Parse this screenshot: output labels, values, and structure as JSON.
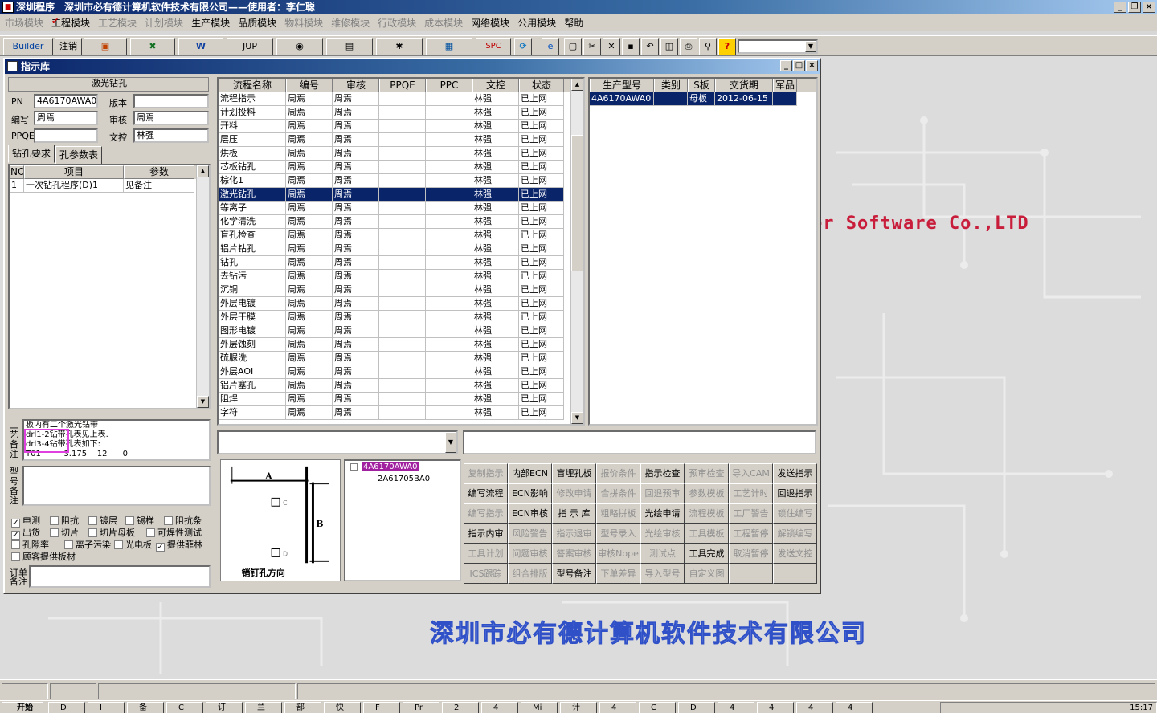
{
  "window": {
    "title": "深圳程序　深圳市必有德计算机软件技术有限公司——使用者：李仁聪"
  },
  "menu": [
    {
      "label": "市场模块",
      "disabled": true,
      "checked": false
    },
    {
      "label": "工程模块",
      "disabled": false,
      "checked": true
    },
    {
      "label": "工艺模块",
      "disabled": true,
      "checked": false
    },
    {
      "label": "计划模块",
      "disabled": true,
      "checked": false
    },
    {
      "label": "生产模块",
      "disabled": false,
      "checked": false
    },
    {
      "label": "品质模块",
      "disabled": false,
      "checked": false
    },
    {
      "label": "物料模块",
      "disabled": true,
      "checked": false
    },
    {
      "label": "维修模块",
      "disabled": true,
      "checked": false
    },
    {
      "label": "行政模块",
      "disabled": true,
      "checked": false
    },
    {
      "label": "成本模块",
      "disabled": true,
      "checked": false
    },
    {
      "label": "网络模块",
      "disabled": false,
      "checked": false
    },
    {
      "label": "公用模块",
      "disabled": false,
      "checked": false
    },
    {
      "label": "帮助",
      "disabled": false,
      "checked": false
    }
  ],
  "toolbar": {
    "builder": "Builder",
    "logout": "注销",
    "jup": "JUP",
    "spc": "SPC"
  },
  "background": {
    "company_en": "er Software Co.,LTD",
    "company_cn": "深圳市必有德计算机软件技术有限公司"
  },
  "child": {
    "title": "指示库"
  },
  "left": {
    "process_name": "激光钻孔",
    "pn_label": "PN",
    "pn_value": "4A6170AWA0",
    "version_label": "版本",
    "version_value": "",
    "author_label": "编写",
    "author_value": "周焉",
    "review_label": "审核",
    "review_value": "周焉",
    "ppqe_label": "PPQE",
    "ppqe_value": "",
    "doc_label": "文控",
    "doc_value": "林强",
    "tabs": [
      "钻孔要求",
      "孔参数表"
    ],
    "grid_headers": [
      "NO",
      "项目",
      "参数"
    ],
    "grid_rows": [
      {
        "no": "1",
        "item": "一次钻孔程序(D)1",
        "param": "见备注"
      }
    ],
    "craft_label": "工艺备注",
    "craft_lines": [
      "板内有二个激光钻带",
      "drl1-2钻带孔表见上表.",
      "drl3-4钻带孔表如下:",
      "T01         3.175    12      0"
    ],
    "model_label": "型号备注",
    "checks": [
      [
        {
          "label": "电测",
          "on": true
        },
        {
          "label": "阻抗",
          "on": false
        },
        {
          "label": "镀层",
          "on": false
        },
        {
          "label": "锡样",
          "on": false
        },
        {
          "label": "阻抗条",
          "on": false
        }
      ],
      [
        {
          "label": "出货",
          "on": true
        },
        {
          "label": "切片",
          "on": false
        },
        {
          "label": "切片母板",
          "on": false
        },
        {
          "label": "可焊性测试",
          "on": false
        }
      ],
      [
        {
          "label": "孔隙率",
          "on": false
        },
        {
          "label": "离子污染",
          "on": false
        },
        {
          "label": "光电板",
          "on": false
        },
        {
          "label": "提供菲林",
          "on": true
        }
      ],
      [
        {
          "label": "顾客提供板材",
          "on": false
        }
      ]
    ],
    "order_label": "订单备注"
  },
  "flow": {
    "headers": [
      "流程名称",
      "编号",
      "审核",
      "PPQE",
      "PPC",
      "文控",
      "状态"
    ],
    "rows": [
      [
        "流程指示",
        "周焉",
        "周焉",
        "",
        "",
        "林强",
        "已上网"
      ],
      [
        "计划投料",
        "周焉",
        "周焉",
        "",
        "",
        "林强",
        "已上网"
      ],
      [
        "开料",
        "周焉",
        "周焉",
        "",
        "",
        "林强",
        "已上网"
      ],
      [
        "层压",
        "周焉",
        "周焉",
        "",
        "",
        "林强",
        "已上网"
      ],
      [
        "烘板",
        "周焉",
        "周焉",
        "",
        "",
        "林强",
        "已上网"
      ],
      [
        "芯板钻孔",
        "周焉",
        "周焉",
        "",
        "",
        "林强",
        "已上网"
      ],
      [
        "棕化1",
        "周焉",
        "周焉",
        "",
        "",
        "林强",
        "已上网"
      ],
      [
        "激光钻孔",
        "周焉",
        "周焉",
        "",
        "",
        "林强",
        "已上网"
      ],
      [
        "等离子",
        "周焉",
        "周焉",
        "",
        "",
        "林强",
        "已上网"
      ],
      [
        "化学清洗",
        "周焉",
        "周焉",
        "",
        "",
        "林强",
        "已上网"
      ],
      [
        "盲孔检查",
        "周焉",
        "周焉",
        "",
        "",
        "林强",
        "已上网"
      ],
      [
        "铝片钻孔",
        "周焉",
        "周焉",
        "",
        "",
        "林强",
        "已上网"
      ],
      [
        "钻孔",
        "周焉",
        "周焉",
        "",
        "",
        "林强",
        "已上网"
      ],
      [
        "去钻污",
        "周焉",
        "周焉",
        "",
        "",
        "林强",
        "已上网"
      ],
      [
        "沉铜",
        "周焉",
        "周焉",
        "",
        "",
        "林强",
        "已上网"
      ],
      [
        "外层电镀",
        "周焉",
        "周焉",
        "",
        "",
        "林强",
        "已上网"
      ],
      [
        "外层干膜",
        "周焉",
        "周焉",
        "",
        "",
        "林强",
        "已上网"
      ],
      [
        "图形电镀",
        "周焉",
        "周焉",
        "",
        "",
        "林强",
        "已上网"
      ],
      [
        "外层蚀刻",
        "周焉",
        "周焉",
        "",
        "",
        "林强",
        "已上网"
      ],
      [
        "硫脲洗",
        "周焉",
        "周焉",
        "",
        "",
        "林强",
        "已上网"
      ],
      [
        "外层AOI",
        "周焉",
        "周焉",
        "",
        "",
        "林强",
        "已上网"
      ],
      [
        "铝片塞孔",
        "周焉",
        "周焉",
        "",
        "",
        "林强",
        "已上网"
      ],
      [
        "阻焊",
        "周焉",
        "周焉",
        "",
        "",
        "林强",
        "已上网"
      ],
      [
        "字符",
        "周焉",
        "周焉",
        "",
        "",
        "林强",
        "已上网"
      ]
    ],
    "selected_index": 7
  },
  "prod": {
    "headers": [
      "生产型号",
      "类别",
      "S板",
      "交货期",
      "军品"
    ],
    "rows": [
      [
        "4A6170AWA0",
        "",
        "母板",
        "2012-06-15",
        ""
      ]
    ]
  },
  "diagram": {
    "a": "A",
    "b": "B",
    "c": "C",
    "d": "D",
    "caption": "销钉孔方向"
  },
  "tree": {
    "root": "4A6170AWA0",
    "child": "2A61705BA0"
  },
  "buttons": [
    {
      "label": "复制指示",
      "enabled": false
    },
    {
      "label": "内部ECN",
      "enabled": true
    },
    {
      "label": "盲埋孔板",
      "enabled": true
    },
    {
      "label": "报价条件",
      "enabled": false
    },
    {
      "label": "指示检查",
      "enabled": true
    },
    {
      "label": "预审检查",
      "enabled": false
    },
    {
      "label": "导入CAM",
      "enabled": false
    },
    {
      "label": "发送指示",
      "enabled": true
    },
    {
      "label": "编写流程",
      "enabled": true
    },
    {
      "label": "ECN影响",
      "enabled": true
    },
    {
      "label": "修改申请",
      "enabled": false
    },
    {
      "label": "合拼条件",
      "enabled": false
    },
    {
      "label": "回退预审",
      "enabled": false
    },
    {
      "label": "参数模板",
      "enabled": false
    },
    {
      "label": "工艺计时",
      "enabled": false
    },
    {
      "label": "回退指示",
      "enabled": true
    },
    {
      "label": "编写指示",
      "enabled": false
    },
    {
      "label": "ECN审核",
      "enabled": true
    },
    {
      "label": "指 示 库",
      "enabled": true
    },
    {
      "label": "粗略拼板",
      "enabled": false
    },
    {
      "label": "光绘申请",
      "enabled": true
    },
    {
      "label": "流程模板",
      "enabled": false
    },
    {
      "label": "工厂警告",
      "enabled": false
    },
    {
      "label": "锁住编写",
      "enabled": false
    },
    {
      "label": "指示内审",
      "enabled": true
    },
    {
      "label": "风险警告",
      "enabled": false
    },
    {
      "label": "指示退审",
      "enabled": false
    },
    {
      "label": "型号录入",
      "enabled": false
    },
    {
      "label": "光绘审核",
      "enabled": false
    },
    {
      "label": "工具模板",
      "enabled": false
    },
    {
      "label": "工程暂停",
      "enabled": false
    },
    {
      "label": "解锁编写",
      "enabled": false
    },
    {
      "label": "工具计划",
      "enabled": false
    },
    {
      "label": "问题审核",
      "enabled": false
    },
    {
      "label": "答案审核",
      "enabled": false
    },
    {
      "label": "审核Nope",
      "enabled": false
    },
    {
      "label": "测试点",
      "enabled": false
    },
    {
      "label": "工具完成",
      "enabled": true
    },
    {
      "label": "取消暂停",
      "enabled": false
    },
    {
      "label": "发送文控",
      "enabled": false
    },
    {
      "label": "ICS跟踪",
      "enabled": false
    },
    {
      "label": "组合排版",
      "enabled": false
    },
    {
      "label": "型号备注",
      "enabled": true
    },
    {
      "label": "下单差异",
      "enabled": false
    },
    {
      "label": "导入型号",
      "enabled": false
    },
    {
      "label": "自定义图",
      "enabled": false
    },
    {
      "label": "",
      "enabled": false
    },
    {
      "label": "",
      "enabled": false
    }
  ],
  "taskbar": {
    "start": "开始",
    "items": [
      "D",
      "I",
      "备",
      "C",
      "订",
      "兰",
      "部",
      "快",
      "F",
      "Pr",
      "2",
      "4",
      "Mi",
      "计",
      "4",
      "C",
      "D",
      "4",
      "4",
      "4",
      "4"
    ],
    "clock": "15:17"
  }
}
